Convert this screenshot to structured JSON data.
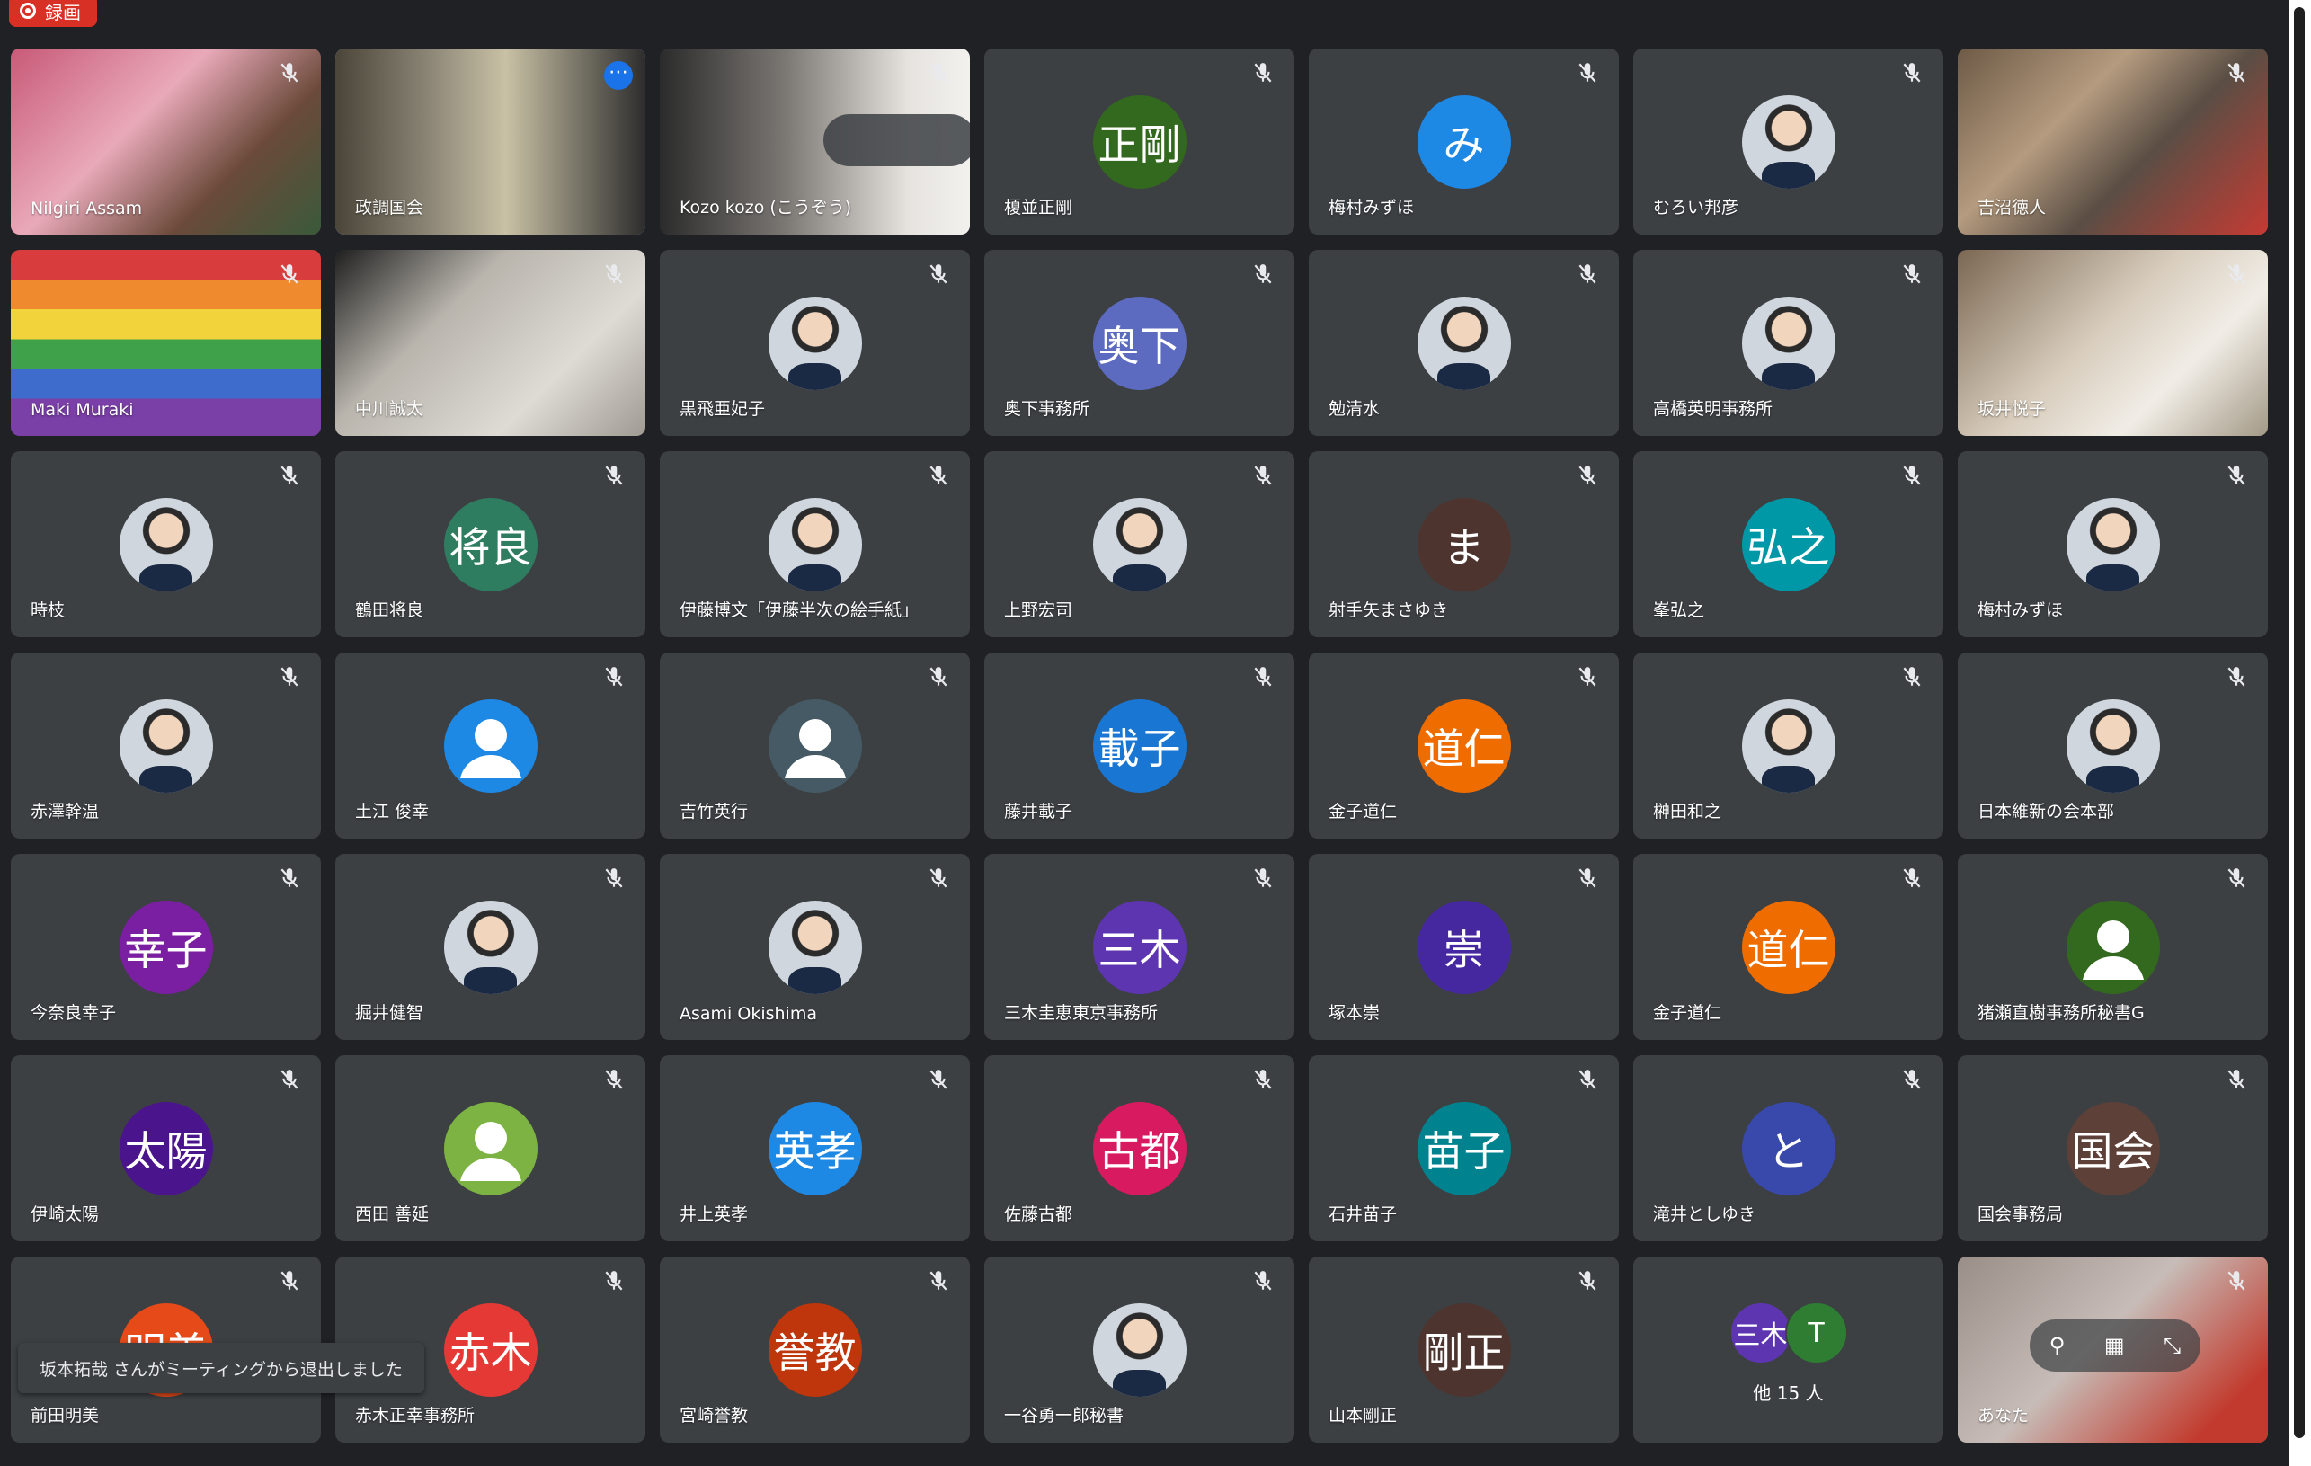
{
  "recording": {
    "label": "録画"
  },
  "colors": {
    "background": "#202124",
    "tile": "#3c4043",
    "accent": "#8ab4f8",
    "recording": "#d93025"
  },
  "tiles": [
    {
      "name": "Nilgiri Assam",
      "kind": "video",
      "scene": "pink-room"
    },
    {
      "name": "政調国会",
      "kind": "video",
      "scene": "office",
      "highlighted": true
    },
    {
      "name": "Kozo kozo (こうぞう)",
      "kind": "video",
      "scene": "bald-man"
    },
    {
      "name": "榎並正剛",
      "kind": "initials",
      "initials": "正剛",
      "color": "#33691e"
    },
    {
      "name": "梅村みずほ",
      "kind": "initials",
      "initials": "み",
      "color": "#1e88e5"
    },
    {
      "name": "むろい邦彦",
      "kind": "photo"
    },
    {
      "name": "吉沼徳人",
      "kind": "video",
      "scene": "shelves"
    },
    {
      "name": "Maki Muraki",
      "kind": "video",
      "scene": "rainbow"
    },
    {
      "name": "中川誠太",
      "kind": "video",
      "scene": "room-clock"
    },
    {
      "name": "黒飛亜妃子",
      "kind": "photo"
    },
    {
      "name": "奥下事務所",
      "kind": "initials",
      "initials": "奥下",
      "color": "#5c6bc0"
    },
    {
      "name": "勉清水",
      "kind": "photo"
    },
    {
      "name": "高橋英明事務所",
      "kind": "photo"
    },
    {
      "name": "坂井悦子",
      "kind": "video",
      "scene": "masked-woman"
    },
    {
      "name": "時枝",
      "kind": "photo"
    },
    {
      "name": "鶴田将良",
      "kind": "initials",
      "initials": "将良",
      "color": "#2e7d61"
    },
    {
      "name": "伊藤博文「伊藤半次の絵手紙」",
      "kind": "photo"
    },
    {
      "name": "上野宏司",
      "kind": "photo"
    },
    {
      "name": "射手矢まさゆき",
      "kind": "initials",
      "initials": "ま",
      "color": "#4e342e"
    },
    {
      "name": "峯弘之",
      "kind": "initials",
      "initials": "弘之",
      "color": "#0097a7"
    },
    {
      "name": "梅村みずほ",
      "kind": "photo"
    },
    {
      "name": "赤澤幹温",
      "kind": "photo"
    },
    {
      "name": "土江 俊幸",
      "kind": "person",
      "color": "#1e88e5"
    },
    {
      "name": "吉竹英行",
      "kind": "person",
      "color": "#455a64"
    },
    {
      "name": "藤井載子",
      "kind": "initials",
      "initials": "載子",
      "color": "#1976d2"
    },
    {
      "name": "金子道仁",
      "kind": "initials",
      "initials": "道仁",
      "color": "#ef6c00"
    },
    {
      "name": "榊田和之",
      "kind": "photo"
    },
    {
      "name": "日本維新の会本部",
      "kind": "photo"
    },
    {
      "name": "今奈良幸子",
      "kind": "initials",
      "initials": "幸子",
      "color": "#7b1fa2"
    },
    {
      "name": "掘井健智",
      "kind": "photo"
    },
    {
      "name": "Asami Okishima",
      "kind": "photo"
    },
    {
      "name": "三木圭恵東京事務所",
      "kind": "initials",
      "initials": "三木",
      "color": "#5e35b1"
    },
    {
      "name": "塚本崇",
      "kind": "initials",
      "initials": "崇",
      "color": "#4527a0"
    },
    {
      "name": "金子道仁",
      "kind": "initials",
      "initials": "道仁",
      "color": "#ef6c00"
    },
    {
      "name": "猪瀬直樹事務所秘書G",
      "kind": "person",
      "color": "#33691e"
    },
    {
      "name": "伊崎太陽",
      "kind": "initials",
      "initials": "太陽",
      "color": "#4a148c"
    },
    {
      "name": "西田 善延",
      "kind": "person",
      "color": "#7cb342"
    },
    {
      "name": "井上英孝",
      "kind": "initials",
      "initials": "英孝",
      "color": "#1e88e5"
    },
    {
      "name": "佐藤古都",
      "kind": "initials",
      "initials": "古都",
      "color": "#d81b60"
    },
    {
      "name": "石井苗子",
      "kind": "initials",
      "initials": "苗子",
      "color": "#00838f"
    },
    {
      "name": "滝井としゆき",
      "kind": "initials",
      "initials": "と",
      "color": "#3949ab"
    },
    {
      "name": "国会事務局",
      "kind": "initials",
      "initials": "国会",
      "color": "#5d4037"
    },
    {
      "name": "前田明美",
      "kind": "initials",
      "initials": "明美",
      "color": "#e64a19"
    },
    {
      "name": "赤木正幸事務所",
      "kind": "initials",
      "initials": "赤木",
      "color": "#e53935"
    },
    {
      "name": "宮崎誉教",
      "kind": "initials",
      "initials": "誉教",
      "color": "#bf360c"
    },
    {
      "name": "一谷勇一郎秘書",
      "kind": "photo"
    },
    {
      "name": "山本剛正",
      "kind": "initials",
      "initials": "剛正",
      "color": "#4e342e"
    },
    {
      "name": "",
      "kind": "others",
      "others_label": "他 15 人",
      "mini": [
        {
          "text": "三木",
          "color": "#5e35b1"
        },
        {
          "text": "T",
          "color": "#2e7d32"
        }
      ]
    },
    {
      "name": "あなた",
      "kind": "self"
    }
  ],
  "toast": {
    "message": "坂本拓哉 さんがミーティングから退出しました"
  }
}
